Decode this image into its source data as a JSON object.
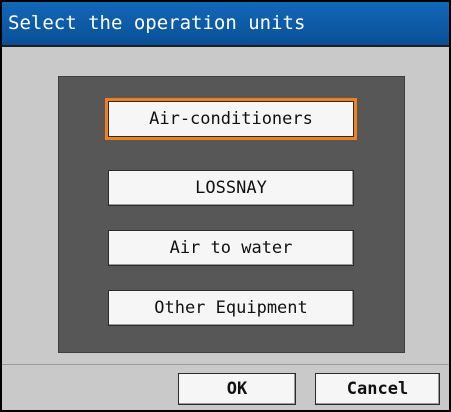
{
  "dialog": {
    "title": "Select the operation units"
  },
  "units": [
    {
      "label": "Air-conditioners",
      "selected": true
    },
    {
      "label": "LOSSNAY",
      "selected": false
    },
    {
      "label": "Air to water",
      "selected": false
    },
    {
      "label": "Other Equipment",
      "selected": false
    }
  ],
  "footer": {
    "ok_label": "OK",
    "cancel_label": "Cancel"
  },
  "colors": {
    "title_bar": "#0a5aa8",
    "selection_border": "#f0801e",
    "panel": "#575757",
    "background": "#c9c9c9"
  }
}
